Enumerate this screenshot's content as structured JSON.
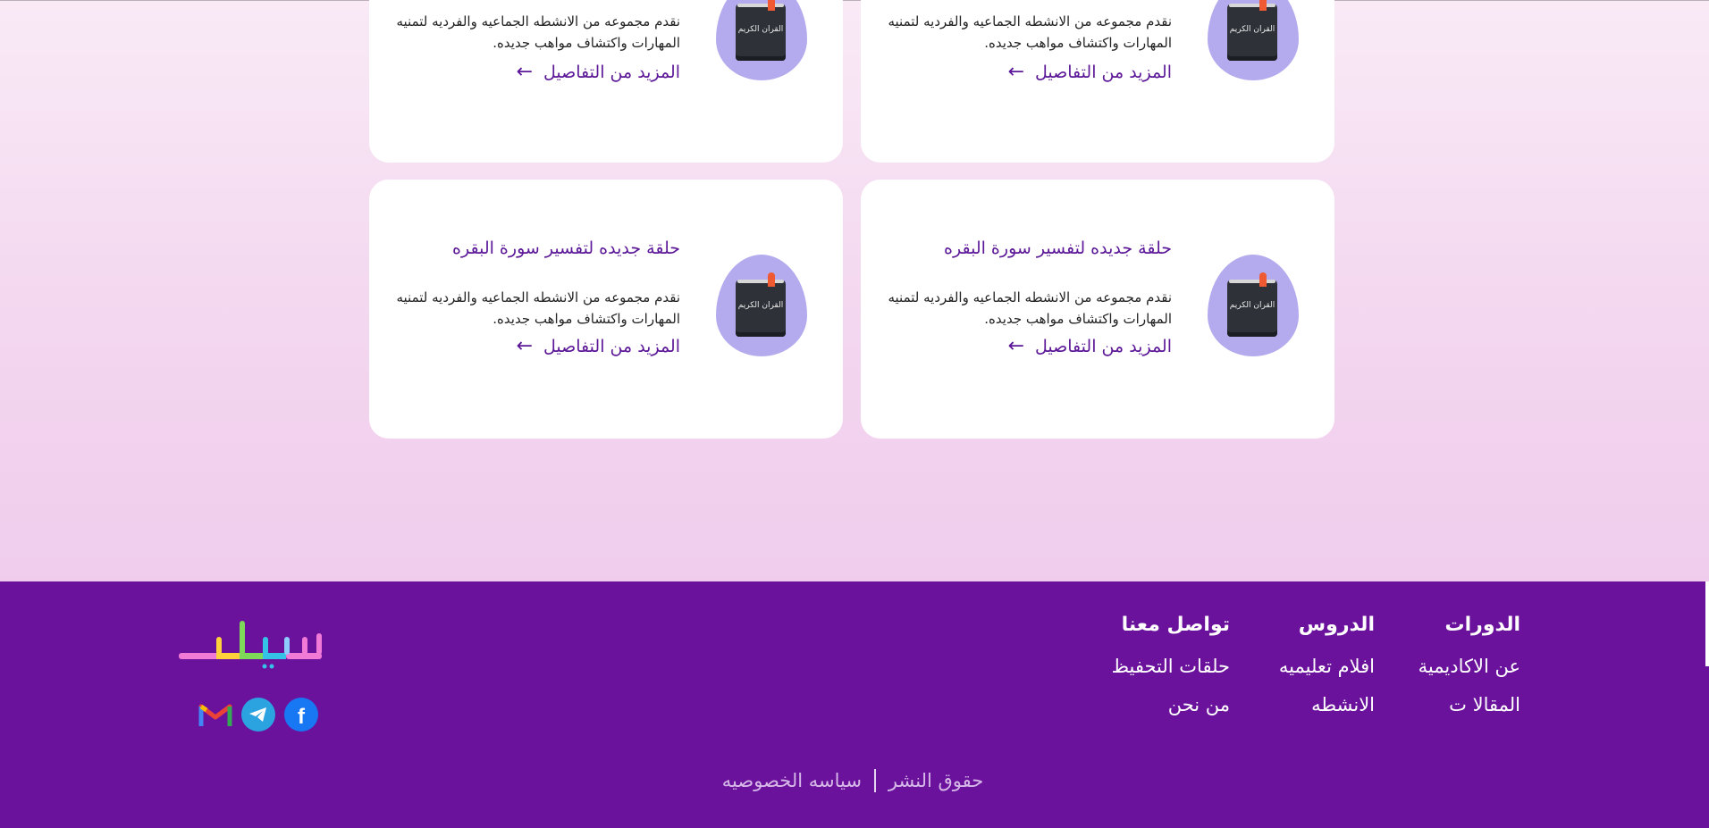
{
  "cards": [
    {
      "title": "",
      "description": "نقدم مجموعه من الانشطه الجماعيه والفرديه لتمنيه المهارات واكتشاف مواهب جديده.",
      "more_label": "المزيد من التفاصيل",
      "book_label": "القران الكريم"
    },
    {
      "title": "",
      "description": "نقدم مجموعه من الانشطه الجماعيه والفرديه لتمنيه المهارات واكتشاف مواهب جديده.",
      "more_label": "المزيد من التفاصيل",
      "book_label": "القران الكريم"
    },
    {
      "title": "حلقة جديده لتفسير سورة البقره",
      "description": "نقدم مجموعه من الانشطه الجماعيه والفرديه لتمنيه المهارات واكتشاف مواهب جديده.",
      "more_label": "المزيد من التفاصيل",
      "book_label": "القران الكريم"
    },
    {
      "title": "حلقة جديده لتفسير سورة البقره",
      "description": "نقدم مجموعه من الانشطه الجماعيه والفرديه لتمنيه المهارات واكتشاف مواهب جديده.",
      "more_label": "المزيد من التفاصيل",
      "book_label": "القران الكريم"
    }
  ],
  "footer": {
    "columns": [
      {
        "heading": "الدورات",
        "links": [
          "عن الاكاديمية",
          "المقالا ت"
        ]
      },
      {
        "heading": "الدروس",
        "links": [
          "افلام تعليميه",
          "الانشطه"
        ]
      },
      {
        "heading": "تواصل معنا",
        "links": [
          "حلقات التحفيظ",
          "من نحن"
        ]
      }
    ],
    "logo_icon": "rainbow-arabic-logo",
    "socials": [
      {
        "name": "facebook-icon",
        "color": "#1877f2"
      },
      {
        "name": "telegram-icon",
        "color": "#2aa3e0"
      },
      {
        "name": "gmail-icon",
        "color": "#ea4335"
      }
    ],
    "bottom_links": [
      "حقوق النشر",
      "سياسه الخصوصيه"
    ]
  },
  "colors": {
    "accent": "#5b1797",
    "footer_bg": "#6b129d",
    "blob": "#b3abee"
  }
}
